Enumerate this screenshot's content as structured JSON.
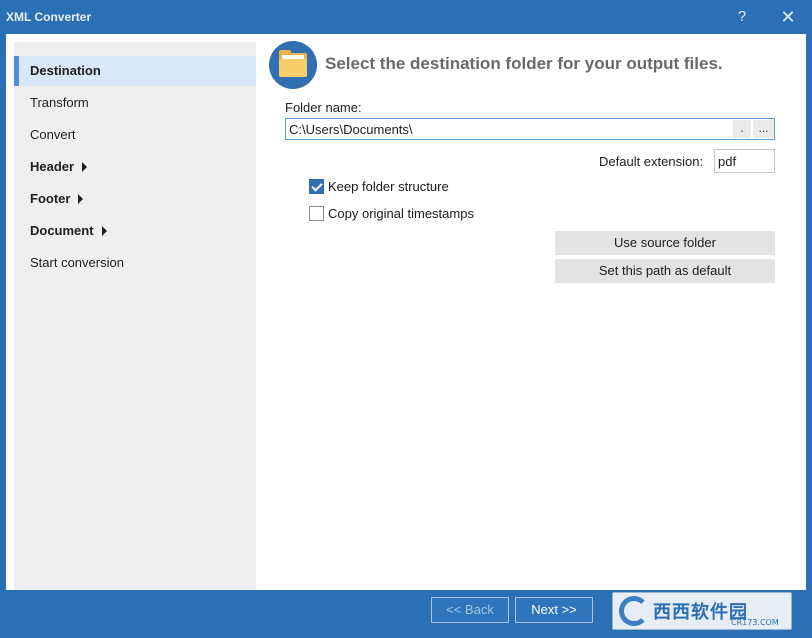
{
  "window": {
    "title": "XML Converter",
    "help_label": "?",
    "close_label": "✕"
  },
  "sidebar": {
    "items": [
      {
        "label": "Destination",
        "selected": true,
        "bold": true,
        "submenu": false
      },
      {
        "label": "Transform",
        "selected": false,
        "bold": false,
        "submenu": false
      },
      {
        "label": "Convert",
        "selected": false,
        "bold": false,
        "submenu": false
      },
      {
        "label": "Header",
        "selected": false,
        "bold": true,
        "submenu": true
      },
      {
        "label": "Footer",
        "selected": false,
        "bold": true,
        "submenu": true
      },
      {
        "label": "Document",
        "selected": false,
        "bold": true,
        "submenu": true
      },
      {
        "label": "Start conversion",
        "selected": false,
        "bold": false,
        "submenu": false
      }
    ]
  },
  "main": {
    "heading": "Select the destination folder for your output files.",
    "folder_label": "Folder name:",
    "folder_value": "C:\\Users\\Documents\\",
    "dot_button": ".",
    "browse_button": "...",
    "ext_label": "Default extension:",
    "ext_value": "pdf",
    "keep_structure": {
      "label": "Keep folder structure",
      "checked": true
    },
    "copy_timestamps": {
      "label": "Copy original timestamps",
      "checked": false
    },
    "use_source_button": "Use source folder",
    "set_default_button": "Set this path as default"
  },
  "footer": {
    "back_label": "<< Back",
    "next_label": "Next >>"
  },
  "watermark": {
    "brand": "西西软件园",
    "site": "CR173.COM"
  },
  "colors": {
    "frame": "#2b6fb4",
    "accent": "#4f8fd6",
    "selected_bg": "#d9e8f7",
    "folder": "#f7cf6a"
  }
}
